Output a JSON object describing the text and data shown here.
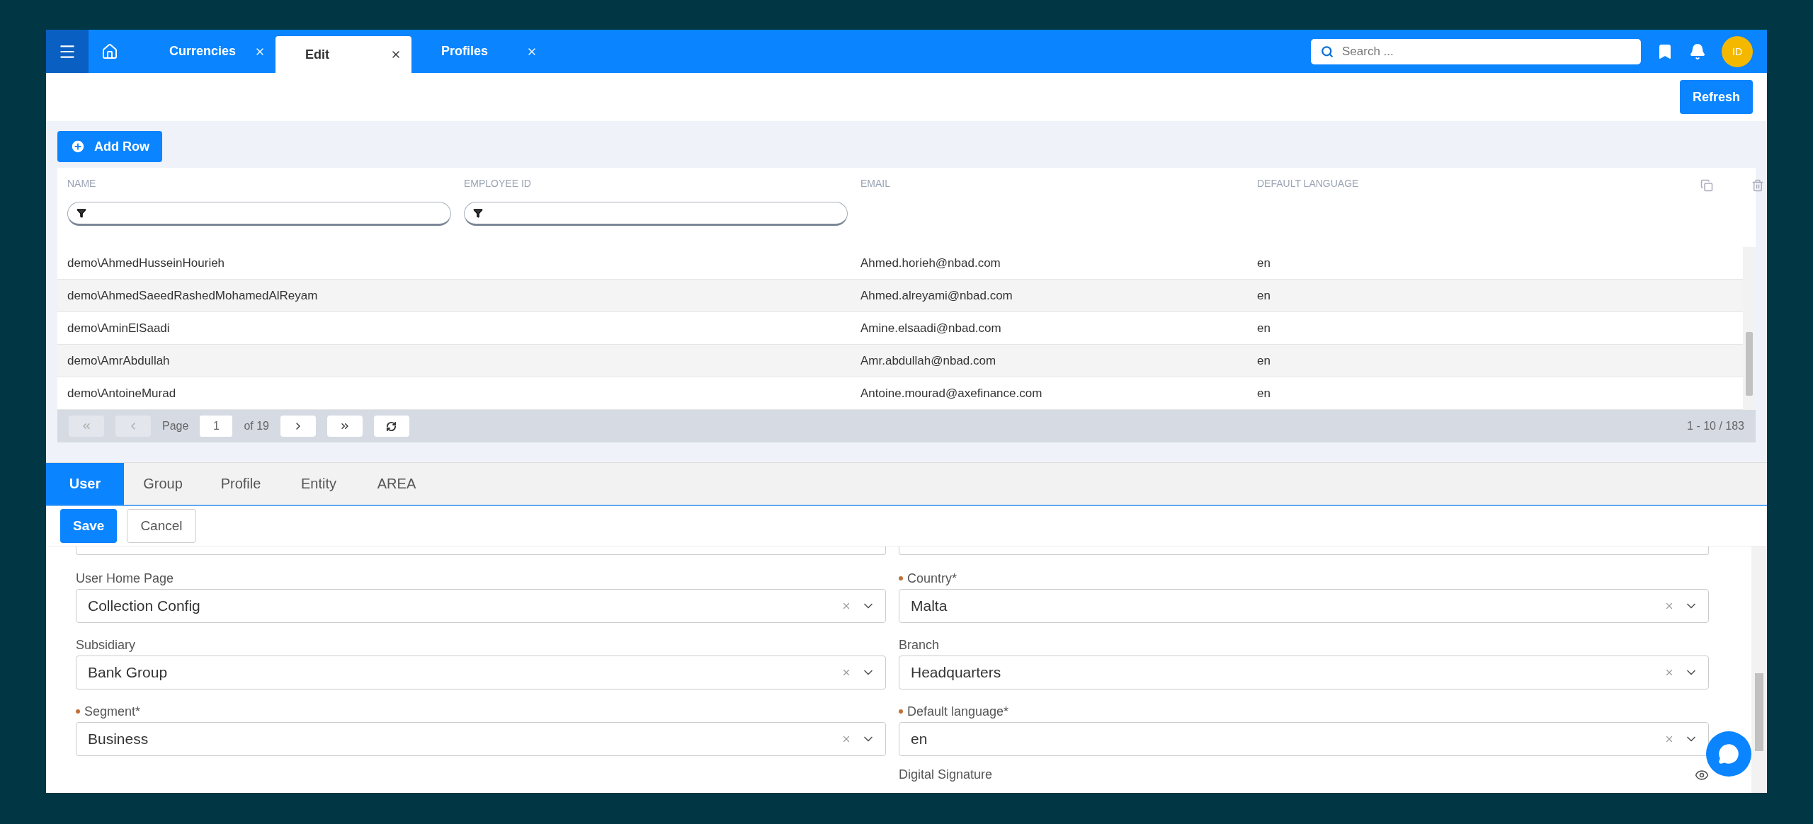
{
  "topbar": {
    "tabs": [
      {
        "label": "Currencies",
        "selected": false
      },
      {
        "label": "Edit",
        "selected": true
      },
      {
        "label": "Profiles",
        "selected": false
      }
    ],
    "search": {
      "placeholder": "Search ..."
    },
    "avatar": "ID"
  },
  "toolbar": {
    "refresh": "Refresh",
    "add_row": "Add Row"
  },
  "table": {
    "columns": [
      "NAME",
      "EMPLOYEE ID",
      "EMAIL",
      "DEFAULT LANGUAGE"
    ],
    "rows": [
      {
        "name": "demo\\AhmedHusseinHourieh",
        "employee_id": "",
        "email": "Ahmed.horieh@nbad.com",
        "language": "en"
      },
      {
        "name": "demo\\AhmedSaeedRashedMohamedAlReyam",
        "employee_id": "",
        "email": "Ahmed.alreyami@nbad.com",
        "language": "en"
      },
      {
        "name": "demo\\AminElSaadi",
        "employee_id": "",
        "email": "Amine.elsaadi@nbad.com",
        "language": "en"
      },
      {
        "name": "demo\\AmrAbdullah",
        "employee_id": "",
        "email": "Amr.abdullah@nbad.com",
        "language": "en"
      },
      {
        "name": "demo\\AntoineMurad",
        "employee_id": "",
        "email": "Antoine.mourad@axefinance.com",
        "language": "en"
      }
    ],
    "pagination": {
      "page_label": "Page",
      "page": "1",
      "of": "of 19",
      "range": "1 - 10 / 183"
    }
  },
  "tabs": [
    {
      "label": "User",
      "selected": true
    },
    {
      "label": "Group",
      "selected": false
    },
    {
      "label": "Profile",
      "selected": false
    },
    {
      "label": "Entity",
      "selected": false
    },
    {
      "label": "AREA",
      "selected": false
    }
  ],
  "actions": {
    "save": "Save",
    "cancel": "Cancel"
  },
  "form": {
    "left": [
      {
        "label": "User Home Page",
        "value": "Collection Config",
        "required": false
      },
      {
        "label": "Subsidiary",
        "value": "Bank Group",
        "required": false
      },
      {
        "label": "Segment*",
        "value": "Business",
        "required": true
      }
    ],
    "right": [
      {
        "label": "Country*",
        "value": "Malta",
        "required": true
      },
      {
        "label": "Branch",
        "value": "Headquarters",
        "required": false
      },
      {
        "label": "Default language*",
        "value": "en",
        "required": true
      }
    ],
    "digital_signature": {
      "label": "Digital Signature"
    }
  }
}
